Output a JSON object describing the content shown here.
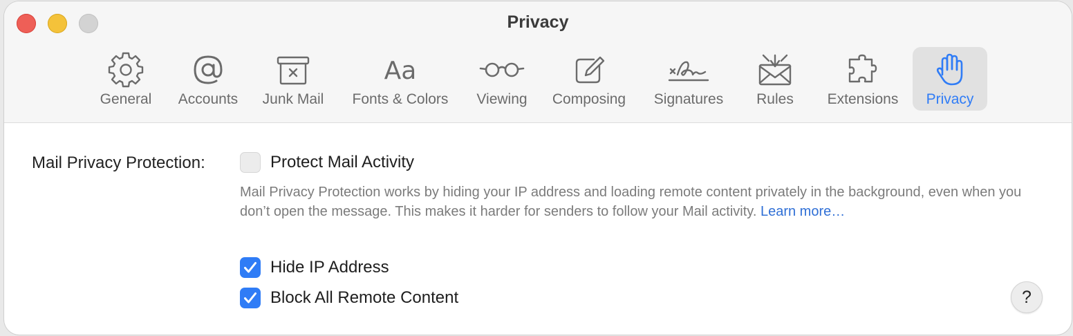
{
  "window": {
    "title": "Privacy"
  },
  "toolbar": {
    "tabs": [
      {
        "label": "General",
        "icon": "gear-icon"
      },
      {
        "label": "Accounts",
        "icon": "at-sign-icon"
      },
      {
        "label": "Junk Mail",
        "icon": "junk-bin-icon"
      },
      {
        "label": "Fonts & Colors",
        "icon": "fonts-icon",
        "glyph": "Aa"
      },
      {
        "label": "Viewing",
        "icon": "glasses-icon"
      },
      {
        "label": "Composing",
        "icon": "compose-icon"
      },
      {
        "label": "Signatures",
        "icon": "signature-icon"
      },
      {
        "label": "Rules",
        "icon": "rules-envelope-icon"
      },
      {
        "label": "Extensions",
        "icon": "puzzle-icon"
      },
      {
        "label": "Privacy",
        "icon": "hand-icon",
        "selected": true
      }
    ]
  },
  "privacy": {
    "section_label": "Mail Privacy Protection:",
    "protect_label": "Protect Mail Activity",
    "protect_checked": false,
    "description": "Mail Privacy Protection works by hiding your IP address and loading remote content privately in the background, even when you don’t open the message. This makes it harder for senders to follow your Mail activity. ",
    "learn_more": "Learn more…",
    "hide_ip_label": "Hide IP Address",
    "hide_ip_checked": true,
    "block_remote_label": "Block All Remote Content",
    "block_remote_checked": true
  },
  "help_button": {
    "label": "?"
  },
  "colors": {
    "accent": "#2f7cf6",
    "link": "#2f6fd6",
    "close": "#ee5f57",
    "minimize": "#f4c23a"
  }
}
